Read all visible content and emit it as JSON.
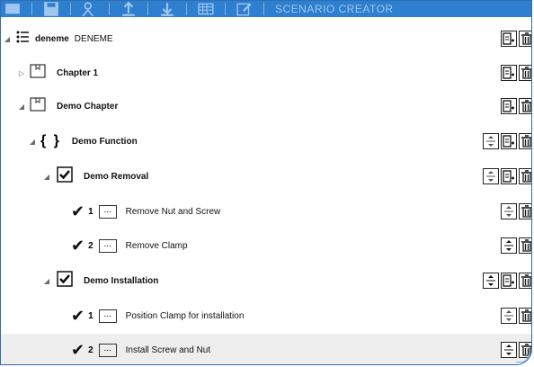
{
  "toolbar": {
    "title": "SCENARIO CREATOR",
    "buttons": [
      "window-icon",
      "save-icon",
      "users-icon",
      "upload-icon",
      "download-icon",
      "grid-icon",
      "edit-icon"
    ]
  },
  "tree": {
    "root": {
      "label_bold": "deneme",
      "label": "DENEME"
    },
    "chapters": [
      {
        "label": "Chapter 1"
      },
      {
        "label": "Demo Chapter"
      }
    ],
    "function": {
      "label": "Demo Function"
    },
    "removal": {
      "label": "Demo Removal",
      "steps": [
        {
          "num": "1",
          "dots": "...",
          "label": "Remove Nut and Screw"
        },
        {
          "num": "2",
          "dots": "...",
          "label": "Remove Clamp"
        }
      ]
    },
    "installation": {
      "label": "Demo Installation",
      "steps": [
        {
          "num": "1",
          "dots": "...",
          "label": "Position Clamp for installation"
        },
        {
          "num": "2",
          "dots": "...",
          "label": "Install Screw and Nut"
        }
      ]
    }
  },
  "colors": {
    "toolbar": "#2e7fd0",
    "toolbar_text": "#9fc6ee",
    "frame_border": "#2f6fb3",
    "selected_row": "#eeeeee"
  }
}
